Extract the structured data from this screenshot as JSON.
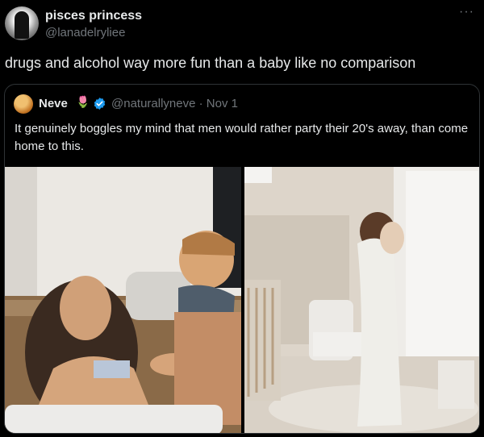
{
  "tweet": {
    "display_name": "pisces princess",
    "handle": "@lanadelryliee",
    "more_icon": "more-dots-icon",
    "text": "drugs and alcohol way more fun than a baby like no comparison"
  },
  "quoted": {
    "display_name": "Neve",
    "emoji": "🌷",
    "verified_color": "#1d9bf0",
    "handle_date": "@naturallyneve · Nov 1",
    "text": "It genuinely boggles my mind that men would rather party their 20's away, than come home to this."
  },
  "colors": {
    "background": "#000000",
    "text_primary": "#e7e9ea",
    "text_secondary": "#71767b",
    "border": "#2f3336"
  }
}
